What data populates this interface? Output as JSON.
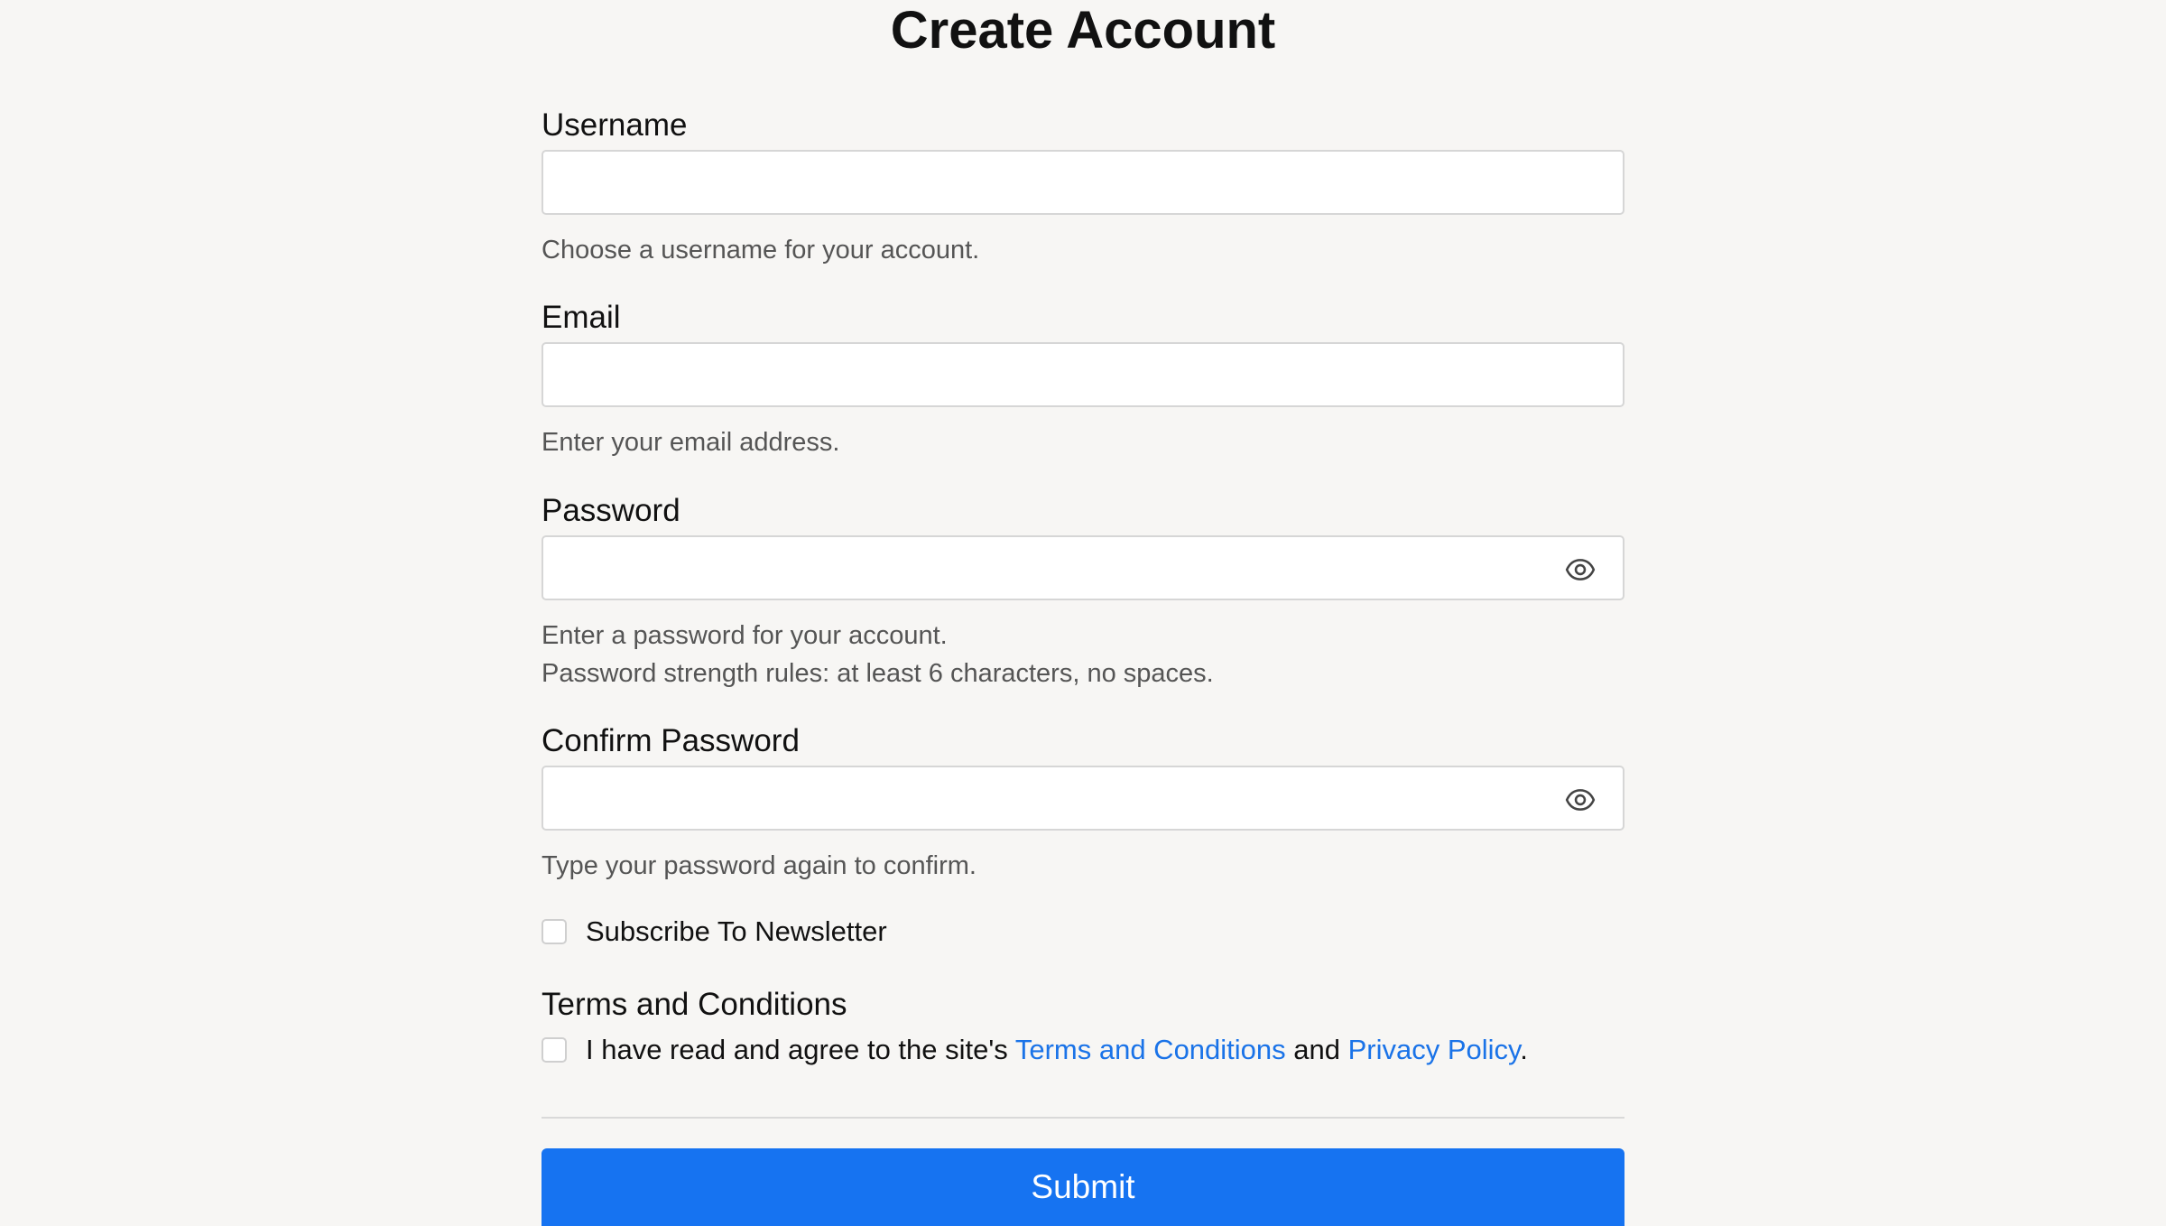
{
  "page": {
    "title": "Create Account"
  },
  "fields": {
    "username": {
      "label": "Username",
      "value": "",
      "help": "Choose a username for your account."
    },
    "email": {
      "label": "Email",
      "value": "",
      "help": "Enter your email address."
    },
    "password": {
      "label": "Password",
      "value": "",
      "help": "Enter a password for your account.",
      "help2": "Password strength rules: at least 6 characters, no spaces.",
      "toggle_icon": "eye-icon"
    },
    "confirm_password": {
      "label": "Confirm Password",
      "value": "",
      "help": "Type your password again to confirm.",
      "toggle_icon": "eye-icon"
    }
  },
  "newsletter": {
    "label": "Subscribe To Newsletter",
    "checked": false
  },
  "terms": {
    "section_title": "Terms and Conditions",
    "text_before": "I have read and agree to the site's ",
    "terms_link": "Terms and Conditions",
    "text_middle": " and ",
    "privacy_link": "Privacy Policy",
    "text_after": ".",
    "checked": false
  },
  "submit": {
    "label": "Submit"
  },
  "colors": {
    "background": "#f7f6f4",
    "primary": "#1673f1",
    "link": "#1a73e8",
    "help_text": "#555555"
  }
}
